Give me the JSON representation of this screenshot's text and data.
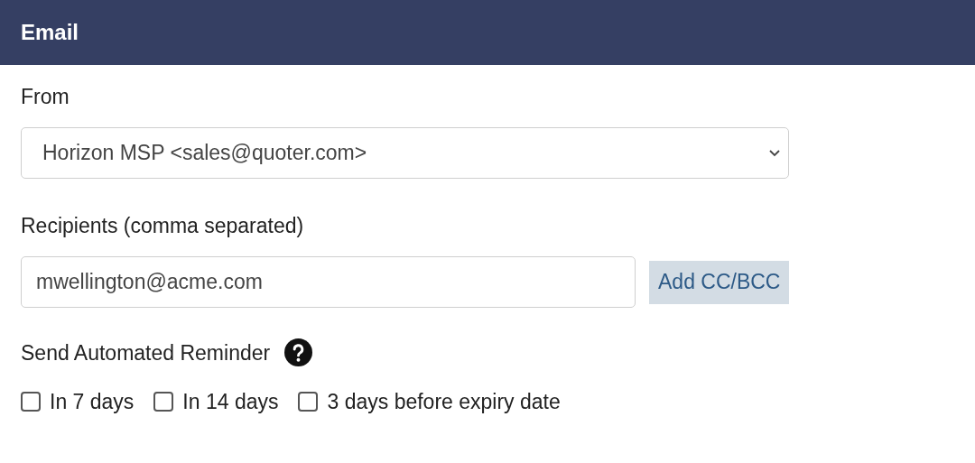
{
  "header": {
    "title": "Email"
  },
  "from": {
    "label": "From",
    "value": "Horizon MSP <sales@quoter.com>"
  },
  "recipients": {
    "label": "Recipients (comma separated)",
    "value": "mwellington@acme.com",
    "button": "Add CC/BCC"
  },
  "reminder": {
    "label": "Send Automated Reminder",
    "options": [
      {
        "label": "In 7 days",
        "checked": false
      },
      {
        "label": "In 14 days",
        "checked": false
      },
      {
        "label": "3 days before expiry date",
        "checked": false
      }
    ]
  }
}
